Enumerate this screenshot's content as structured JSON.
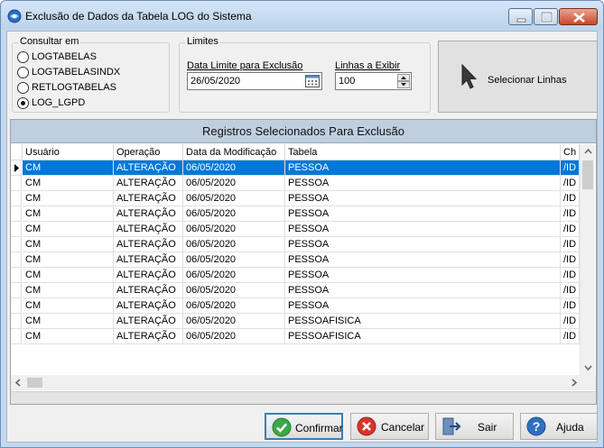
{
  "window": {
    "title": "Exclusão de Dados da Tabela LOG do Sistema"
  },
  "consult": {
    "title": "Consultar em",
    "options": [
      "LOGTABELAS",
      "LOGTABELASINDX",
      "RETLOGTABELAS",
      "LOG_LGPD"
    ],
    "selected": "LOG_LGPD"
  },
  "limits": {
    "title": "Limites",
    "date_label": "Data Limite para Exclusão",
    "date_value": "26/05/2020",
    "lines_label": "Linhas a Exibir",
    "lines_value": "100"
  },
  "select_lines_button": "Selecionar Linhas",
  "grid": {
    "caption": "Registros Selecionados Para Exclusão",
    "columns": [
      "Usuário",
      "Operação",
      "Data da Modificação",
      "Tabela",
      "Ch"
    ],
    "rows": [
      [
        "CM",
        "ALTERAÇÃO",
        "06/05/2020",
        "PESSOA",
        "/ID"
      ],
      [
        "CM",
        "ALTERAÇÃO",
        "06/05/2020",
        "PESSOA",
        "/ID"
      ],
      [
        "CM",
        "ALTERAÇÃO",
        "06/05/2020",
        "PESSOA",
        "/ID"
      ],
      [
        "CM",
        "ALTERAÇÃO",
        "06/05/2020",
        "PESSOA",
        "/ID"
      ],
      [
        "CM",
        "ALTERAÇÃO",
        "06/05/2020",
        "PESSOA",
        "/ID"
      ],
      [
        "CM",
        "ALTERAÇÃO",
        "06/05/2020",
        "PESSOA",
        "/ID"
      ],
      [
        "CM",
        "ALTERAÇÃO",
        "06/05/2020",
        "PESSOA",
        "/ID"
      ],
      [
        "CM",
        "ALTERAÇÃO",
        "06/05/2020",
        "PESSOA",
        "/ID"
      ],
      [
        "CM",
        "ALTERAÇÃO",
        "06/05/2020",
        "PESSOA",
        "/ID"
      ],
      [
        "CM",
        "ALTERAÇÃO",
        "06/05/2020",
        "PESSOA",
        "/ID"
      ],
      [
        "CM",
        "ALTERAÇÃO",
        "06/05/2020",
        "PESSOAFISICA",
        "/ID"
      ],
      [
        "CM",
        "ALTERAÇÃO",
        "06/05/2020",
        "PESSOAFISICA",
        "/ID"
      ]
    ],
    "selected_row": 0
  },
  "buttons": {
    "confirm": "Confirmar",
    "cancel": "Cancelar",
    "exit": "Sair",
    "help": "Ajuda"
  },
  "colors": {
    "selection": "#0078d7",
    "caption_bar": "#bfcfe0"
  }
}
